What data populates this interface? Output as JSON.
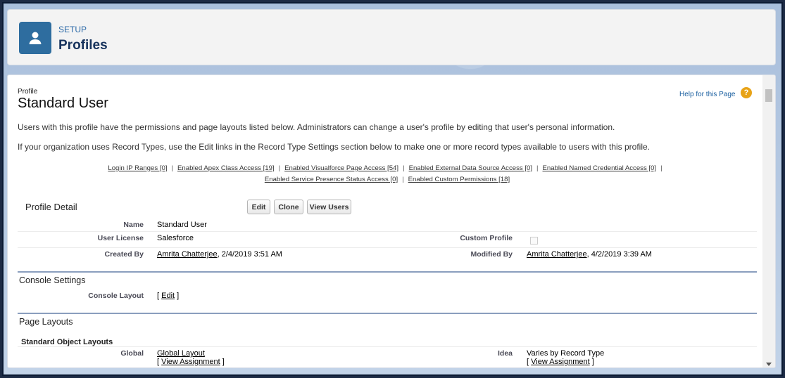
{
  "header": {
    "eyebrow": "SETUP",
    "title": "Profiles",
    "icon": "user-icon"
  },
  "profile": {
    "label": "Profile",
    "name": "Standard User",
    "help_link": "Help for this Page",
    "help_icon": "?",
    "description1": "Users with this profile have the permissions and page layouts listed below. Administrators can change a user's profile by editing that user's personal information.",
    "description2": "If your organization uses Record Types, use the Edit links in the Record Type Settings section below to make one or more record types available to users with this profile."
  },
  "related_links": {
    "row1": [
      "Login IP Ranges [0]",
      "Enabled Apex Class Access [19]",
      "Enabled Visualforce Page Access [54]",
      "Enabled External Data Source Access [0]",
      "Enabled Named Credential Access [0]"
    ],
    "row2": [
      "Enabled Service Presence Status Access [0]",
      "Enabled Custom Permissions [18]"
    ],
    "separator": "|"
  },
  "detail": {
    "title": "Profile Detail",
    "buttons": {
      "edit": "Edit",
      "clone": "Clone",
      "view_users": "View Users"
    },
    "name_label": "Name",
    "name_value": "Standard User",
    "license_label": "User License",
    "license_value": "Salesforce",
    "custom_label": "Custom Profile",
    "created_label": "Created By",
    "created_user": "Amrita Chatterjee",
    "created_date": ", 2/4/2019 3:51 AM",
    "modified_label": "Modified By",
    "modified_user": "Amrita Chatterjee",
    "modified_date": ", 4/2/2019 3:39 AM"
  },
  "console": {
    "title": "Console Settings",
    "layout_label": "Console Layout",
    "edit_open": "[ ",
    "edit_link": "Edit",
    "edit_close": " ]"
  },
  "page_layouts": {
    "title": "Page Layouts",
    "subtitle": "Standard Object Layouts",
    "global_label": "Global",
    "global_value": "Global Layout",
    "idea_label": "Idea",
    "idea_value": "Varies by Record Type",
    "bracket_open": "[ ",
    "view_assignment": "View Assignment",
    "bracket_close": " ]"
  }
}
